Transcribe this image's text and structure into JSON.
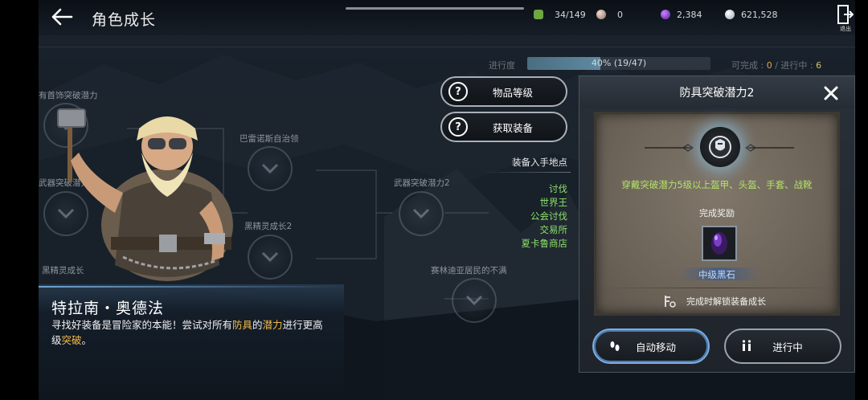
{
  "header": {
    "title": "角色成长",
    "resources": [
      {
        "name": "tickets",
        "value": "34/149",
        "icon": "green-ticket-icon"
      },
      {
        "name": "pearl",
        "value": "0",
        "icon": "pearl-icon"
      },
      {
        "name": "black-stone-energy",
        "value": "2,384",
        "icon": "purple-orb-icon"
      },
      {
        "name": "silver",
        "value": "621,528",
        "icon": "silver-coin-icon"
      }
    ],
    "exit_label": "退出"
  },
  "progress": {
    "label": "进行度",
    "percent": 40,
    "text": "40% (19/47)",
    "completable_label": "可完成 :",
    "completable_value": "0",
    "separator": "/",
    "in_progress_label": "进行中 :",
    "in_progress_value": "6"
  },
  "tree": {
    "nodes": [
      {
        "label": "有首饰突破潜力"
      },
      {
        "label": "武器突破潜力"
      },
      {
        "label": "黑精灵成长"
      },
      {
        "label": "巴雷诺斯自治领"
      },
      {
        "label": "黑精灵成长2"
      },
      {
        "label": "武器突破潜力2"
      },
      {
        "label": "赛林迪亚居民的不满"
      }
    ]
  },
  "character": {
    "name": "特拉南・奥德法",
    "desc_parts": [
      "寻找好装备是冒险家的本能！尝试对所有",
      "防具",
      "的",
      "潜力",
      "进行更高级",
      "突破",
      "。"
    ]
  },
  "actions": {
    "item_grade": "物品等级",
    "get_equipment": "获取装备"
  },
  "acquisition": {
    "title": "装备入手地点",
    "items": [
      "讨伐",
      "世界王",
      "公会讨伐",
      "交易所",
      "夏卡鲁商店"
    ]
  },
  "panel": {
    "title": "防具突破潜力2",
    "requirement": "穿戴突破潜力5级以上盔甲、头盔、手套、战靴",
    "reward_label": "完成奖励",
    "reward_name": "中级黑石",
    "unlock_text": "完成时解锁装备成长",
    "btn_auto": "自动移动",
    "btn_progress": "进行中"
  },
  "colors": {
    "accent_green": "#8de06a",
    "highlight_gold": "#f1b947",
    "req_green": "#b3e36a",
    "reward_blue": "#b9d8ff"
  }
}
